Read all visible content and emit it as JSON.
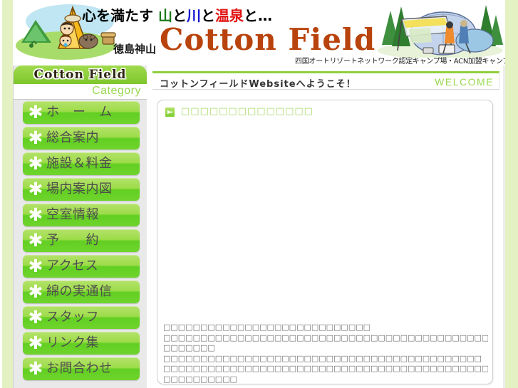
{
  "header": {
    "tagline_plain_1": "心を満たす ",
    "tagline_mountain": "山",
    "tagline_to_1": "と",
    "tagline_river": "川",
    "tagline_to_2": "と",
    "tagline_onsen": "温泉",
    "tagline_tail": "と…",
    "brand_jp": "徳島神山",
    "brand_en": "Cotton Field",
    "certification_note": "四国オートリゾートネットワーク認定キャンプ場・ACN加盟キャンプ場",
    "left_illustration_name": "tent-family-raccoon-illustration",
    "right_illustration_name": "campsite-tent-photo-illustration"
  },
  "sidebar": {
    "title": "Cotton Field",
    "category_label": "Category",
    "bullet_icon": "asterisk-icon",
    "items": [
      {
        "label": "ホ　ー　ム"
      },
      {
        "label": "総合案内"
      },
      {
        "label": "施設＆料金"
      },
      {
        "label": "場内案内図"
      },
      {
        "label": "空室情報"
      },
      {
        "label": "予　　約"
      },
      {
        "label": "アクセス"
      },
      {
        "label": "綿の実通信"
      },
      {
        "label": "スタッフ"
      },
      {
        "label": "リンク集"
      },
      {
        "label": "お問合わせ"
      }
    ]
  },
  "main": {
    "page_title": "コットンフィールドWebsiteへようこそ！",
    "page_title_en": "WELCOME",
    "card": {
      "arrow_icon": "green-arrow-icon",
      "heading": "□□□□□□□□□□□□□□",
      "body_lines": [
        "□□□□□□□□□□□□□□□□□□□□□□□□□□□□",
        "□□□□□□□□□□□□□□□□□□□□□□□□□□□□□□□□□□□□□□□□□□□□□□□□□□□□",
        "□□□□□□□",
        "□□□□□□□□□□□□□□□□□□□□□□□□□□□□□□□□□□□□□□□□□□□",
        "□□□□□□□□□□□□□□□□□□□□□□□□□□□□□□□□□□□□□□□□□□□□□□□□□□□□",
        "□□□□□□□□□□"
      ]
    }
  },
  "colors": {
    "accent_green": "#8ed13a",
    "pale_green": "#e4f1c3",
    "brand_red": "#b9430d",
    "label_green": "#9ad84f",
    "sidebar_bg": "#e9e9e9"
  }
}
